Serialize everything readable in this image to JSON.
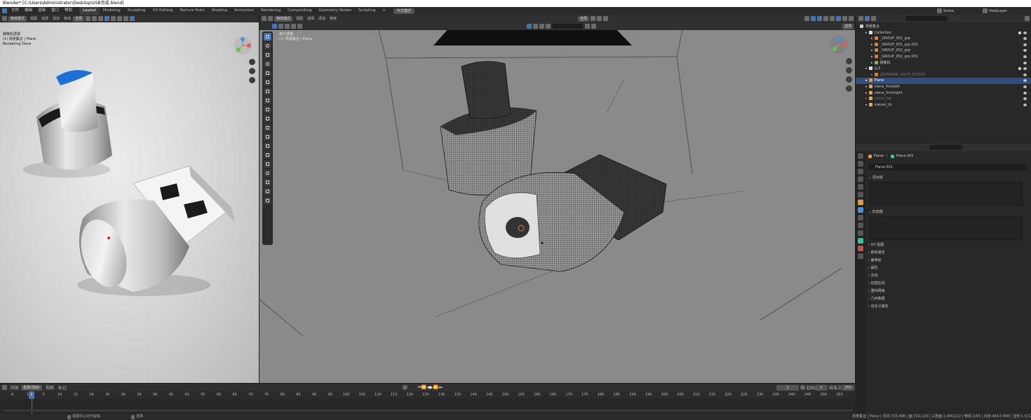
{
  "window": {
    "title": "Blender* [C:\\Users\\Administrator\\Desktop\\USB完成.blend]"
  },
  "menu": [
    "文件",
    "编辑",
    "渲染",
    "窗口",
    "帮助"
  ],
  "workspaces": [
    "Layout",
    "Modeling",
    "Sculpting",
    "UV Editing",
    "Texture Paint",
    "Shading",
    "Animation",
    "Rendering",
    "Compositing",
    "Geometry Nodes",
    "Scripting"
  ],
  "workspace_add": "中文模式",
  "scene": {
    "label": "Scene",
    "view_layer": "ViewLayer"
  },
  "left_view": {
    "mode": "物体模式",
    "menus": [
      "视图",
      "选择",
      "添加",
      "物体"
    ],
    "transform": "全局",
    "options": "选项",
    "overlay": [
      "摄像机透视",
      "(1) 场景集合 | Plane",
      "Rendering Done"
    ]
  },
  "main_view": {
    "mode": "物体模式",
    "menus": [
      "视图",
      "选择",
      "添加",
      "物体"
    ],
    "transform": "全局",
    "options": "选项",
    "overlay": [
      "用户透视",
      "(1) 场景集合 | Plane"
    ]
  },
  "outliner": {
    "root": "场景集合",
    "rows": [
      {
        "label": "Collection",
        "indent": 1,
        "icon": "collection-icon"
      },
      {
        "label": "_GROUP_001_grp",
        "indent": 2,
        "icon": "empty-icon"
      },
      {
        "label": "_GROUP_001_grp.001",
        "indent": 2,
        "icon": "empty-icon"
      },
      {
        "label": "_GROUP_002_grp",
        "indent": 2,
        "icon": "empty-icon"
      },
      {
        "label": "_GROUP_002_grp.001",
        "indent": 2,
        "icon": "empty-icon"
      },
      {
        "label": "摄像机",
        "indent": 2,
        "icon": "camera-icon"
      },
      {
        "label": "LLS",
        "indent": 1,
        "icon": "collection-icon"
      },
      {
        "label": "LEOMOON_LIGHT_STUDIO",
        "indent": 2,
        "icon": "empty-icon",
        "dim": true
      },
      {
        "label": "Plane",
        "indent": 1,
        "icon": "mesh-icon",
        "selected": true
      },
      {
        "label": "vieira_frontleft",
        "indent": 1,
        "icon": "light-icon"
      },
      {
        "label": "vieira_frontright",
        "indent": 1,
        "icon": "light-icon"
      },
      {
        "label": "vieira_top",
        "indent": 1,
        "icon": "light-icon",
        "dim": true
      },
      {
        "label": "vieiran_tb",
        "indent": 1,
        "icon": "light-icon"
      }
    ]
  },
  "properties": {
    "breadcrumb": [
      "Plane",
      "Plane.001"
    ],
    "mesh_name": "Plane.001",
    "sections": [
      "顶点组",
      "形态键"
    ],
    "collapsed": [
      "UV 贴图",
      "颜色属性",
      "面映射",
      "属性",
      "法向",
      "纹理空间",
      "重构网格",
      "几何数据",
      "自定义属性"
    ]
  },
  "timeline": {
    "menus": [
      "回放",
      "抠像(插帧)",
      "视图",
      "标记"
    ],
    "current_frame": "1",
    "start_label": "起始",
    "start": "1",
    "end_label": "结束点",
    "end": "250",
    "ticks": [
      "-5",
      "1",
      "5",
      "10",
      "15",
      "20",
      "25",
      "30",
      "35",
      "40",
      "45",
      "50",
      "55",
      "60",
      "65",
      "70",
      "75",
      "80",
      "85",
      "90",
      "95",
      "100",
      "105",
      "110",
      "115",
      "120",
      "125",
      "130",
      "135",
      "140",
      "145",
      "150",
      "155",
      "160",
      "165",
      "170",
      "175",
      "180",
      "185",
      "190",
      "195",
      "200",
      "205",
      "210",
      "215",
      "220",
      "225",
      "230",
      "235",
      "240",
      "245",
      "250",
      "255"
    ]
  },
  "status": {
    "left1": "视图中心对齐鼠标",
    "left2": "选择",
    "right": "场景集合 | Plane | 顶点:720,496 | 面:720,129 | 三角面:1,440,222 | 物体:1/65 | 内存:444.0 MiB | 显存:1.5/12.0 GiB | 3.1"
  }
}
